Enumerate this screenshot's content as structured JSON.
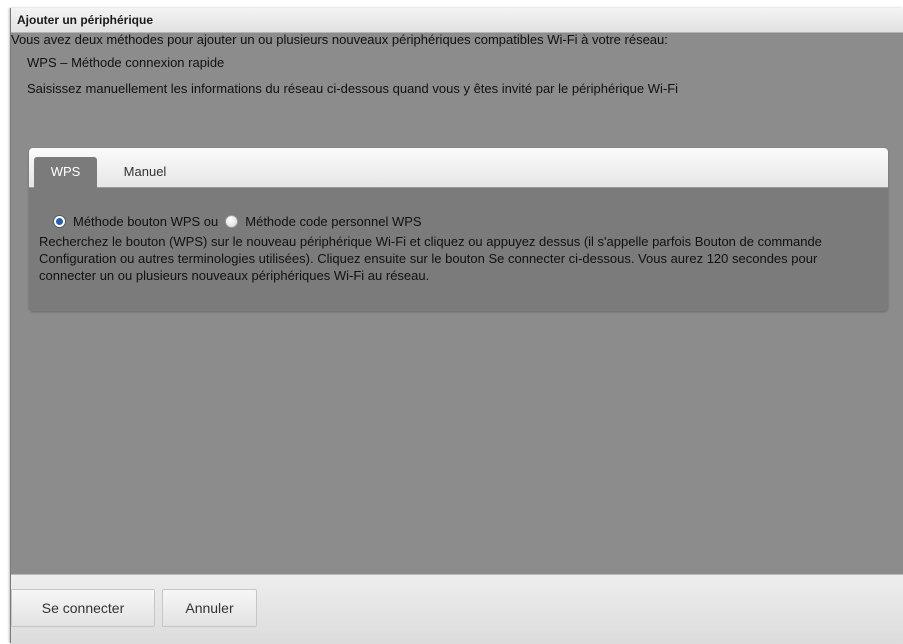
{
  "dialog": {
    "title": "Ajouter un périphérique",
    "intro": "Vous avez deux méthodes pour ajouter un ou plusieurs nouveaux périphériques compatibles Wi-Fi à votre réseau:",
    "method_wps": "WPS – Méthode connexion rapide",
    "method_manual": "Saisissez manuellement les informations du réseau ci-dessous quand vous y êtes invité par le périphérique Wi-Fi"
  },
  "tabs": [
    {
      "label": "WPS",
      "active": true
    },
    {
      "label": "Manuel",
      "active": false
    }
  ],
  "wps": {
    "radio_button_label": "Méthode bouton WPS ou",
    "radio_button_checked": true,
    "radio_pin_label": "Méthode code personnel WPS",
    "radio_pin_checked": false,
    "description": "Recherchez le bouton (WPS) sur le nouveau périphérique Wi-Fi et cliquez ou appuyez dessus (il s'appelle parfois Bouton de commande Configuration ou autres terminologies utilisées). Cliquez ensuite sur le bouton Se connecter ci-dessous. Vous aurez 120 secondes pour connecter un ou plusieurs nouveaux périphériques Wi-Fi au réseau."
  },
  "footer": {
    "connect_label": "Se connecter",
    "cancel_label": "Annuler"
  },
  "colors": {
    "panel_background": "#8c8c8c",
    "tab_panel_background": "#7b7b7b",
    "radio_selected": "#1f5fc4"
  },
  "icons": {
    "radio_selected": "radio-selected-icon",
    "radio_unselected": "radio-unselected-icon"
  }
}
